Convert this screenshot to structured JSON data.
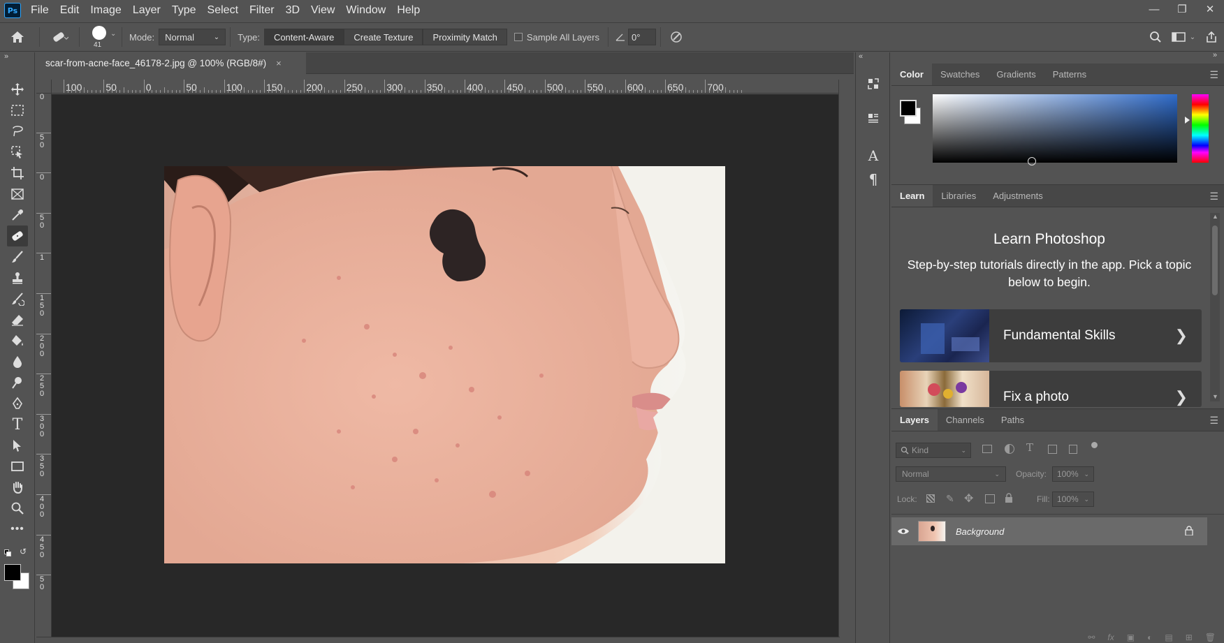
{
  "menubar": {
    "logo": "Ps",
    "items": [
      "File",
      "Edit",
      "Image",
      "Layer",
      "Type",
      "Select",
      "Filter",
      "3D",
      "View",
      "Window",
      "Help"
    ]
  },
  "options": {
    "brush_size": "41",
    "mode_label": "Mode:",
    "mode_value": "Normal",
    "type_label": "Type:",
    "type_buttons": [
      "Content-Aware",
      "Create Texture",
      "Proximity Match"
    ],
    "sample_all_layers": "Sample All Layers",
    "angle_value": "0°"
  },
  "document": {
    "tab_title": "scar-from-acne-face_46178-2.jpg @ 100% (RGB/8#)",
    "close": "×"
  },
  "rulers": {
    "top": [
      "100",
      "50",
      "0",
      "50",
      "100",
      "150",
      "200",
      "250",
      "300",
      "350",
      "400",
      "450",
      "500",
      "550",
      "600",
      "650",
      "700"
    ],
    "left": [
      "0",
      "50",
      "0",
      "50",
      "1",
      "150",
      "200",
      "250",
      "300",
      "350",
      "400",
      "450",
      "50"
    ]
  },
  "color_panel": {
    "tabs": [
      "Color",
      "Swatches",
      "Gradients",
      "Patterns"
    ],
    "foreground": "#000000",
    "background": "#ffffff"
  },
  "learn_panel": {
    "tabs": [
      "Learn",
      "Libraries",
      "Adjustments"
    ],
    "title": "Learn Photoshop",
    "description": "Step-by-step tutorials directly in the app. Pick a topic below to begin.",
    "cards": [
      {
        "label": "Fundamental Skills"
      },
      {
        "label": "Fix a photo"
      }
    ]
  },
  "layers_panel": {
    "tabs": [
      "Layers",
      "Channels",
      "Paths"
    ],
    "filter_kind": "Kind",
    "blend_mode": "Normal",
    "opacity_label": "Opacity:",
    "opacity_value": "100%",
    "lock_label": "Lock:",
    "fill_label": "Fill:",
    "fill_value": "100%",
    "layers": [
      {
        "name": "Background",
        "visible": true,
        "locked": true
      }
    ]
  }
}
